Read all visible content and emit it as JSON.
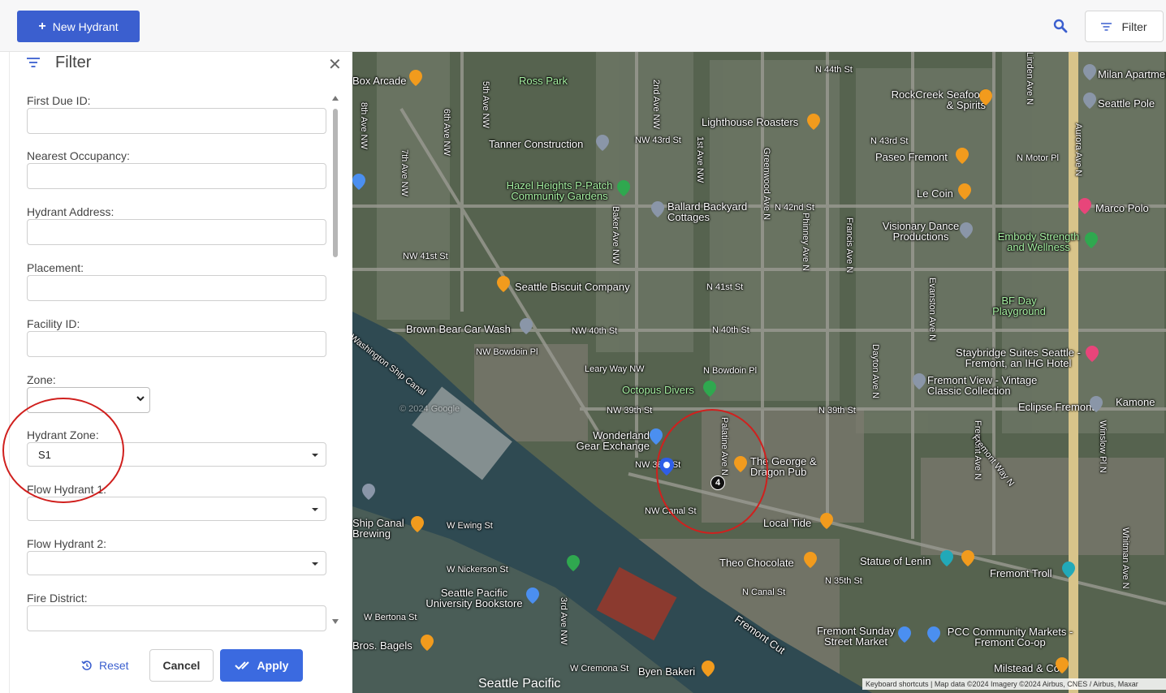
{
  "toolbar": {
    "new_button_label": "New Hydrant",
    "filter_button_label": "Filter"
  },
  "filter_panel": {
    "title": "Filter",
    "fields": [
      {
        "label": "First Due ID:",
        "value": ""
      },
      {
        "label": "Nearest Occupancy:",
        "value": ""
      },
      {
        "label": "Hydrant Address:",
        "value": ""
      },
      {
        "label": "Placement:",
        "value": ""
      },
      {
        "label": "Facility ID:",
        "value": ""
      },
      {
        "label": "Zone:",
        "value": ""
      },
      {
        "label": "Hydrant Zone:",
        "value": "S1"
      },
      {
        "label": "Flow Hydrant 1:",
        "value": ""
      },
      {
        "label": "Flow Hydrant 2:",
        "value": ""
      },
      {
        "label": "Fire District:",
        "value": ""
      }
    ],
    "reset_label": "Reset",
    "cancel_label": "Cancel",
    "apply_label": "Apply"
  },
  "map": {
    "cluster_count": "4",
    "attribution": "Keyboard shortcuts | Map data ©2024 Imagery ©2024 Airbus, CNES / Airbus, Maxar",
    "watermark": "© 2024 Google",
    "pois": [
      "Box Arcade",
      "Ross Park",
      "Milan Apartments",
      "RockCreek Seafood & Spirits",
      "Seattle Pole",
      "Lighthouse Roasters",
      "Tanner Construction",
      "Paseo Fremont",
      "Hazel Heights P-Patch Community Gardens",
      "Ballard Backyard Cottages",
      "Le Coin",
      "Marco Polo",
      "Visionary Dance Productions",
      "Embody Strength and Wellness",
      "Seattle Biscuit Company",
      "BF Day Playground",
      "Brown Bear Car Wash",
      "Staybridge Suites Seattle - Fremont, an IHG Hotel",
      "Fremont View - Vintage Classic Collection",
      "Octopus Divers",
      "Eclipse Fremont",
      "Kamone",
      "Wonderland Gear Exchange",
      "The George & Dragon Pub",
      "Local Tide",
      "Ship Canal Brewing",
      "Theo Chocolate",
      "Statue of Lenin",
      "Fremont Troll",
      "Seattle Pacific University Bookstore",
      "Fremont Sunday Street Market",
      "PCC Community Markets - Fremont Co-op",
      "Bros. Bagels",
      "Byen Bakeri",
      "Milstead & Co",
      "Seattle Pacific"
    ],
    "streets": [
      "N 44th St",
      "NW 43rd St",
      "N 43rd St",
      "N Motor Pl",
      "N 42nd St",
      "NW 41st St",
      "N 41st St",
      "NW 40th St",
      "N 40th St",
      "NW Bowdoin Pl",
      "N Bowdoin Pl",
      "NW 39th St",
      "N 39th St",
      "NW 38th St",
      "NW Canal St",
      "W Ewing St",
      "W Nickerson St",
      "N 35th St",
      "N Canal St",
      "W Bertona St",
      "W Cremona St",
      "Leary Way NW",
      "6th Ave NW",
      "8th Ave NW",
      "7th Ave NW",
      "5th Ave NW",
      "3rd Ave NW",
      "2nd Ave NW",
      "1st Ave NW",
      "Baker Ave NW",
      "Greenwood Ave N",
      "Phinney Ave N",
      "Francis Ave N",
      "Evanston Ave N",
      "Aurora Ave N",
      "Linden Ave N",
      "Palatine Ave N",
      "Dayton Ave N",
      "Fremont Ave N",
      "Fremont Way N",
      "Winslow Pl N",
      "Whitman Ave N",
      "Washington Ship Canal",
      "Fremont Cut"
    ]
  }
}
